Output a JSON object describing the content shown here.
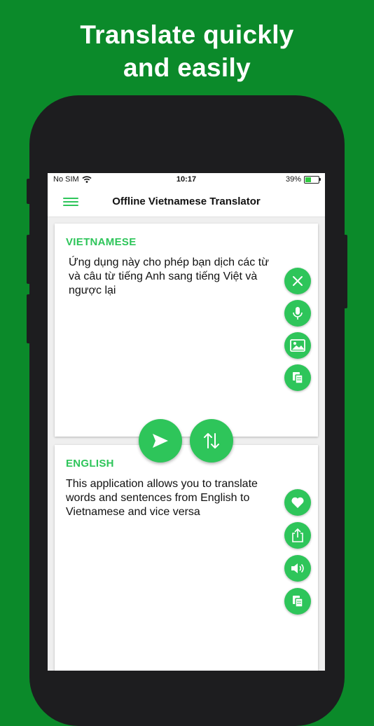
{
  "promo": {
    "line1": "Translate quickly",
    "line2": "and easily"
  },
  "status_bar": {
    "carrier": "No SIM",
    "time": "10:17",
    "battery": "39%"
  },
  "header": {
    "title": "Offline Vietnamese Translator",
    "menu_icon": "hamburger-menu-icon"
  },
  "source": {
    "language": "VIETNAMESE",
    "text": "Ứng dụng này cho phép bạn dịch các từ và câu từ tiếng Anh sang tiếng Việt và ngược lại",
    "actions": [
      "close-icon",
      "microphone-icon",
      "image-icon",
      "paste-icon"
    ]
  },
  "target": {
    "language": "ENGLISH",
    "text": "This application allows you to translate words and sentences from English to Vietnamese and vice versa",
    "actions": [
      "heart-icon",
      "share-icon",
      "speaker-icon",
      "copy-icon"
    ]
  },
  "controls": [
    "send-icon",
    "swap-icon"
  ],
  "colors": {
    "background": "#0b8a2a",
    "accent": "#2ec55a",
    "phone_frame": "#1d1d1f"
  }
}
